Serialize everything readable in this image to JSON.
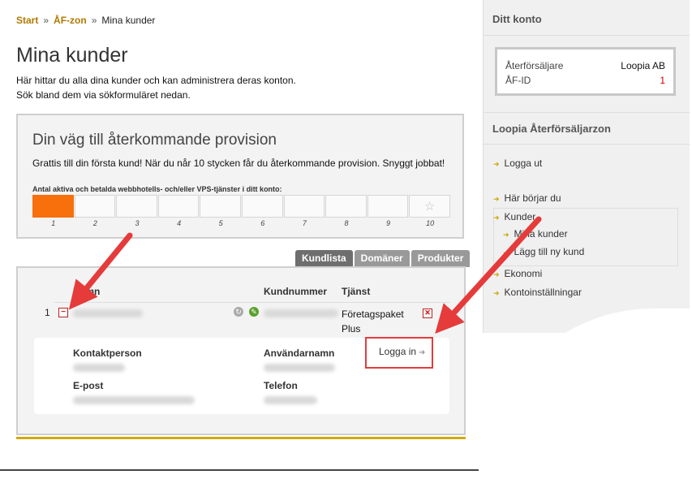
{
  "breadcrumb": {
    "start": "Start",
    "sep1": "»",
    "zone": "ÅF-zon",
    "sep2": "»",
    "current": "Mina kunder"
  },
  "page": {
    "title": "Mina kunder",
    "intro1": "Här hittar du alla dina kunder och kan administrera deras konton.",
    "intro2": "Sök bland dem via sökformuläret nedan."
  },
  "provision": {
    "title": "Din väg till återkommande provision",
    "subtitle": "Grattis till din första kund! När du når 10 stycken får du återkommande provision. Snyggt jobbat!",
    "count_label": "Antal aktiva och betalda webbhotells- och/eller VPS-tjänster i ditt konto:",
    "progress_value": 1,
    "progress_max": 10,
    "ticks": [
      "1",
      "2",
      "3",
      "4",
      "5",
      "6",
      "7",
      "8",
      "9",
      "10"
    ],
    "star_icon": "star-icon"
  },
  "tabs": [
    {
      "label": "Kundlista",
      "active": true
    },
    {
      "label": "Domäner",
      "active": false
    },
    {
      "label": "Produkter",
      "active": false
    }
  ],
  "customers": {
    "col_name": "Namn",
    "col_number": "Kundnummer",
    "col_service": "Tjänst",
    "row": {
      "index": "1",
      "service": "Företagspaket Plus",
      "contact_label": "Kontaktperson",
      "email_label": "E-post",
      "username_label": "Användarnamn",
      "phone_label": "Telefon",
      "login_label": "Logga in"
    }
  },
  "sidebar": {
    "account_title": "Ditt konto",
    "reseller_label": "Återförsäljare",
    "reseller_value": "Loopia AB",
    "afid_label": "ÅF-ID",
    "afid_value": "1",
    "zone_title": "Loopia Återförsäljarzon",
    "items": {
      "logout": "Logga ut",
      "start_here": "Här börjar du",
      "customers": "Kunder",
      "my_customers": "Mina kunder",
      "add_customer": "Lägg till ny kund",
      "economy": "Ekonomi",
      "settings": "Kontoinställningar"
    }
  },
  "colors": {
    "accent": "#f7700b",
    "link": "#b07a00",
    "highlight": "#e53b3b",
    "gold": "#cfa90b"
  }
}
